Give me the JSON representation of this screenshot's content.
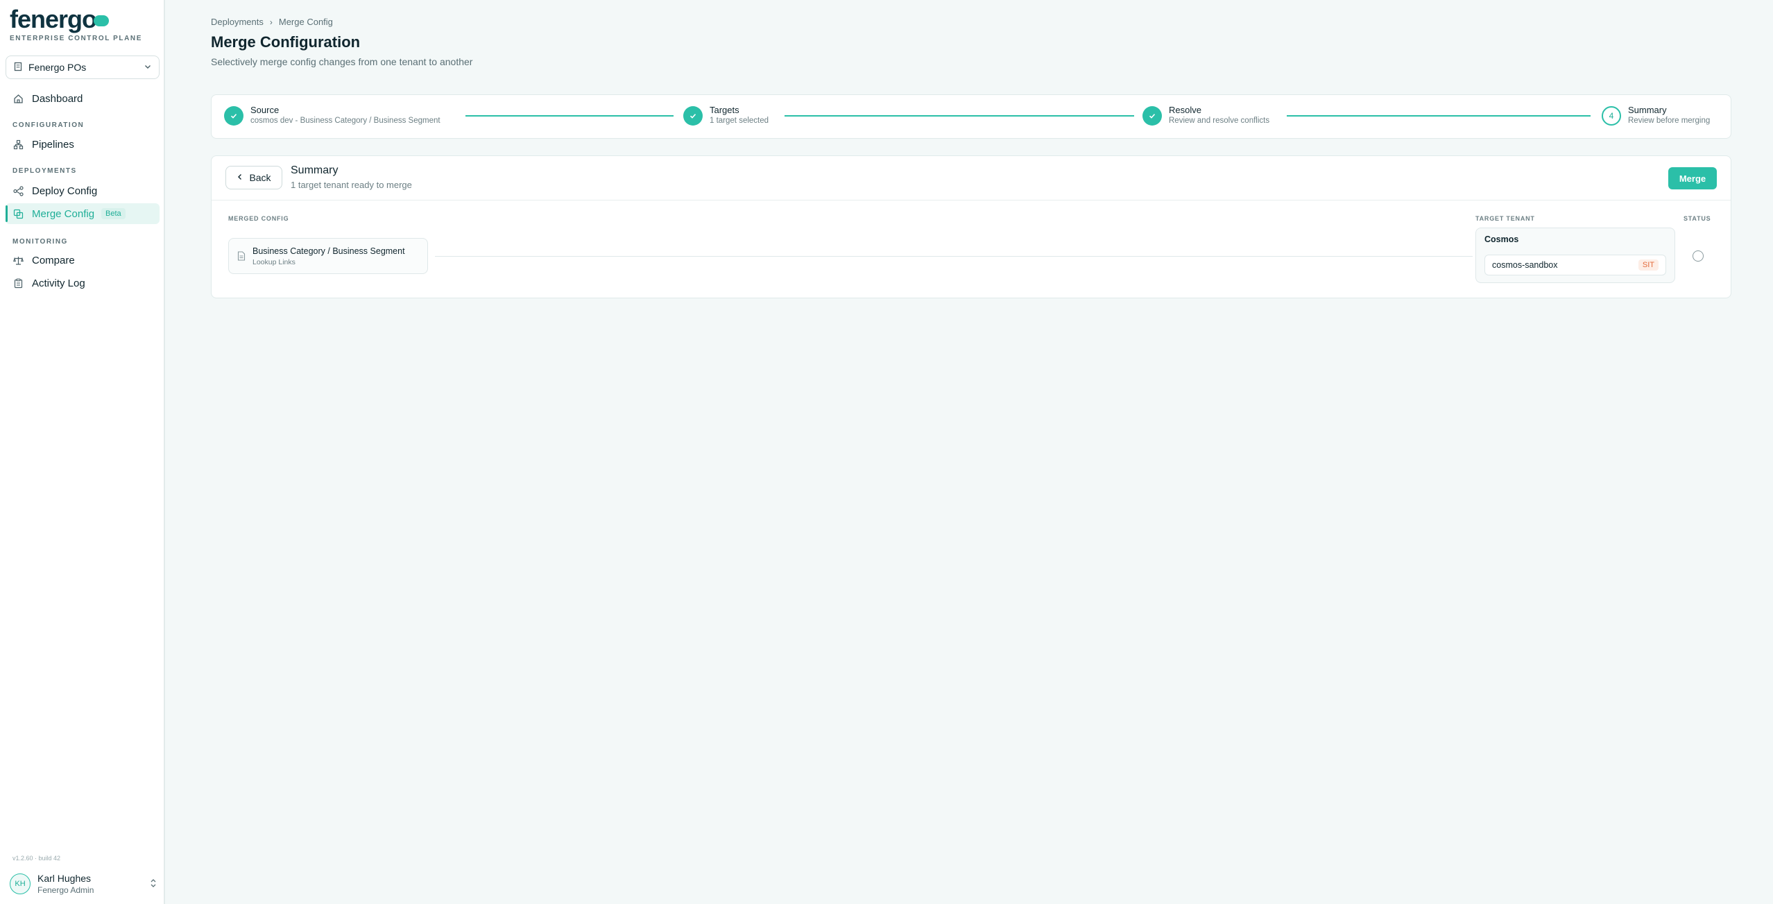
{
  "sidebar": {
    "logo_text": "fenergo",
    "logo_sub": "ENTERPRISE CONTROL PLANE",
    "org": "Fenergo POs",
    "sections": {
      "configuration": "CONFIGURATION",
      "deployments": "DEPLOYMENTS",
      "monitoring": "MONITORING"
    },
    "items": {
      "dashboard": "Dashboard",
      "pipelines": "Pipelines",
      "deploy_config": "Deploy Config",
      "merge_config": "Merge Config",
      "compare": "Compare",
      "activity_log": "Activity Log"
    },
    "beta_badge": "Beta",
    "version": "v1.2.60 · build 42",
    "user": {
      "initials": "KH",
      "name": "Karl Hughes",
      "role": "Fenergo Admin"
    }
  },
  "breadcrumb": [
    "Deployments",
    "Merge Config"
  ],
  "page": {
    "title": "Merge Configuration",
    "subtitle": "Selectively merge config changes from one tenant to another"
  },
  "steps": [
    {
      "title": "Source",
      "desc": "cosmos dev - Business Category / Business Segment",
      "done": true
    },
    {
      "title": "Targets",
      "desc": "1 target selected",
      "done": true
    },
    {
      "title": "Resolve",
      "desc": "Review and resolve conflicts",
      "done": true
    },
    {
      "title": "Summary",
      "desc": "Review before merging",
      "number": "4",
      "done": false
    }
  ],
  "summary": {
    "back_label": "Back",
    "title": "Summary",
    "subtitle": "1 target tenant ready to merge",
    "merge_label": "Merge",
    "columns": {
      "merged_config": "MERGED CONFIG",
      "target_tenant": "TARGET TENANT",
      "status": "STATUS"
    },
    "config": {
      "title": "Business Category / Business Segment",
      "subtitle": "Lookup Links"
    },
    "tenant": {
      "name": "Cosmos",
      "environment": "cosmos-sandbox",
      "badge": "SIT"
    }
  },
  "colors": {
    "accent": "#2bbfa8",
    "badge_sit": "#e36b3c"
  }
}
